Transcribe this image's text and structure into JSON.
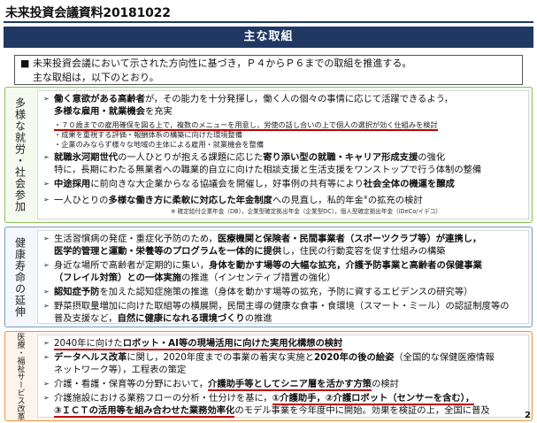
{
  "doc_title": "未来投資会議資料20181022",
  "banner": "主な取組",
  "intro": {
    "marker": "■",
    "line1": "未来投資会議において示された方向性に基づき，Ｐ４からＰ６までの取組を推進する。",
    "line2": "主な取組は，以下のとおり。"
  },
  "bullet": "➢",
  "sections": {
    "employment": {
      "label": "多様な就労・社会参加",
      "l1a": "働く意欲がある高齢者",
      "l1b": "が，その能力を十分発揮し，働く人の個々の事情に応じて活躍できるよう，",
      "l2a": "多様な雇用・就業機会",
      "l2b": "を充実",
      "s1": "・７０歳までの雇用確保を図る上で，複数のメニューを用意し，労使の話し合いの上で個人の選択が効く仕組みを検討",
      "s2": "・成果を重視する評価・報酬体系の構築に向けた環境整備",
      "s3": "・企業のみならず様々な地域の主体による雇用・就業機会を整備",
      "l3a": "就職氷河期世代",
      "l3b": "の一人ひとりが抱える課題に応じた",
      "l3c": "寄り添い型の就職・キャリア形成支援",
      "l3d": "の強化",
      "l4": "特に，長期にわたる無業者への職業的自立に向けた相談支援と生活支援をワンストップで行う体制の整備",
      "l5a": "中途採用",
      "l5b": "に前向きな大企業からなる協議会を開催し，好事例の共有等により",
      "l5c": "社会全体の機運を醸成",
      "l6a": "一人ひとりの",
      "l6b": "多様な働き方に柔軟に対応した年金制度",
      "l6c": "への見直し，私的年金",
      "l6d": "の拡充の検討",
      "note": "※ 確定給付企業年金（DB），企業型確定拠出年金（企業型DC），個人型確定拠出年金（iDeCo/イデコ）"
    },
    "health": {
      "label": "健康寿命の延伸",
      "l1a": "生活習慣病の発症・重症化予防のため，",
      "l1b": "医療機関と保険者・民間事業者（スポーツクラブ等）が連携し，",
      "l2a": "医学的管理と運動・栄養等のプログラムを一体的に提供",
      "l2b": "し，住民の行動変容を促す仕組みの構築",
      "l3a": "身近な場所で高齢者が定期的に集い，",
      "l3b": "身体を動かす場等の大幅な拡充，介護予防事業と高齢者の保健事業",
      "l4a": "（フレイル対策）との一体実施",
      "l4b": "の推進（インセンティブ措置の強化）",
      "l5a": "認知症予防",
      "l5b": "を加えた認知症施策の推進（身体を動かす場等の拡充，予防に資するエビデンスの研究等）",
      "l6": "野菜摂取量増加に向けた取組等の横展開，民間主導の健康な食事・食環境（スマート・ミール）の認証制度等の",
      "l7a": "普及支援など，",
      "l7b": "自然に健康になれる環境づくり",
      "l7c": "の推進"
    },
    "care": {
      "label": "医療・福祉サービス改革",
      "l1a": "2040年に向けた",
      "l1b": "ロボット・AI等の現場活用に向けた実用化構想の検討",
      "l2a": "データヘルス改革",
      "l2b": "に関し，2020年度までの事業の着実な実施と",
      "l2c": "2020年の後の絵姿",
      "l2d": "（全国的な保健医療情報",
      "l3": "ネットワーク等），工程表の策定",
      "l4a": "介護・看護・保育等の分野において，",
      "l4b": "介護助手等としてシニア層を活かす方策",
      "l4c": "の検討",
      "l5a": "介護施設における業務フローの分析・仕分けを基に，",
      "l5b": "①介護助手，②介護ロボット（センサーを含む），",
      "l6a": "③ＩＣＴの活用等を組み合わせた業務効率化",
      "l6b": "のモデル事業を今年度中に開始。効果を検証の上，全国に普及"
    }
  },
  "page_number": "2"
}
